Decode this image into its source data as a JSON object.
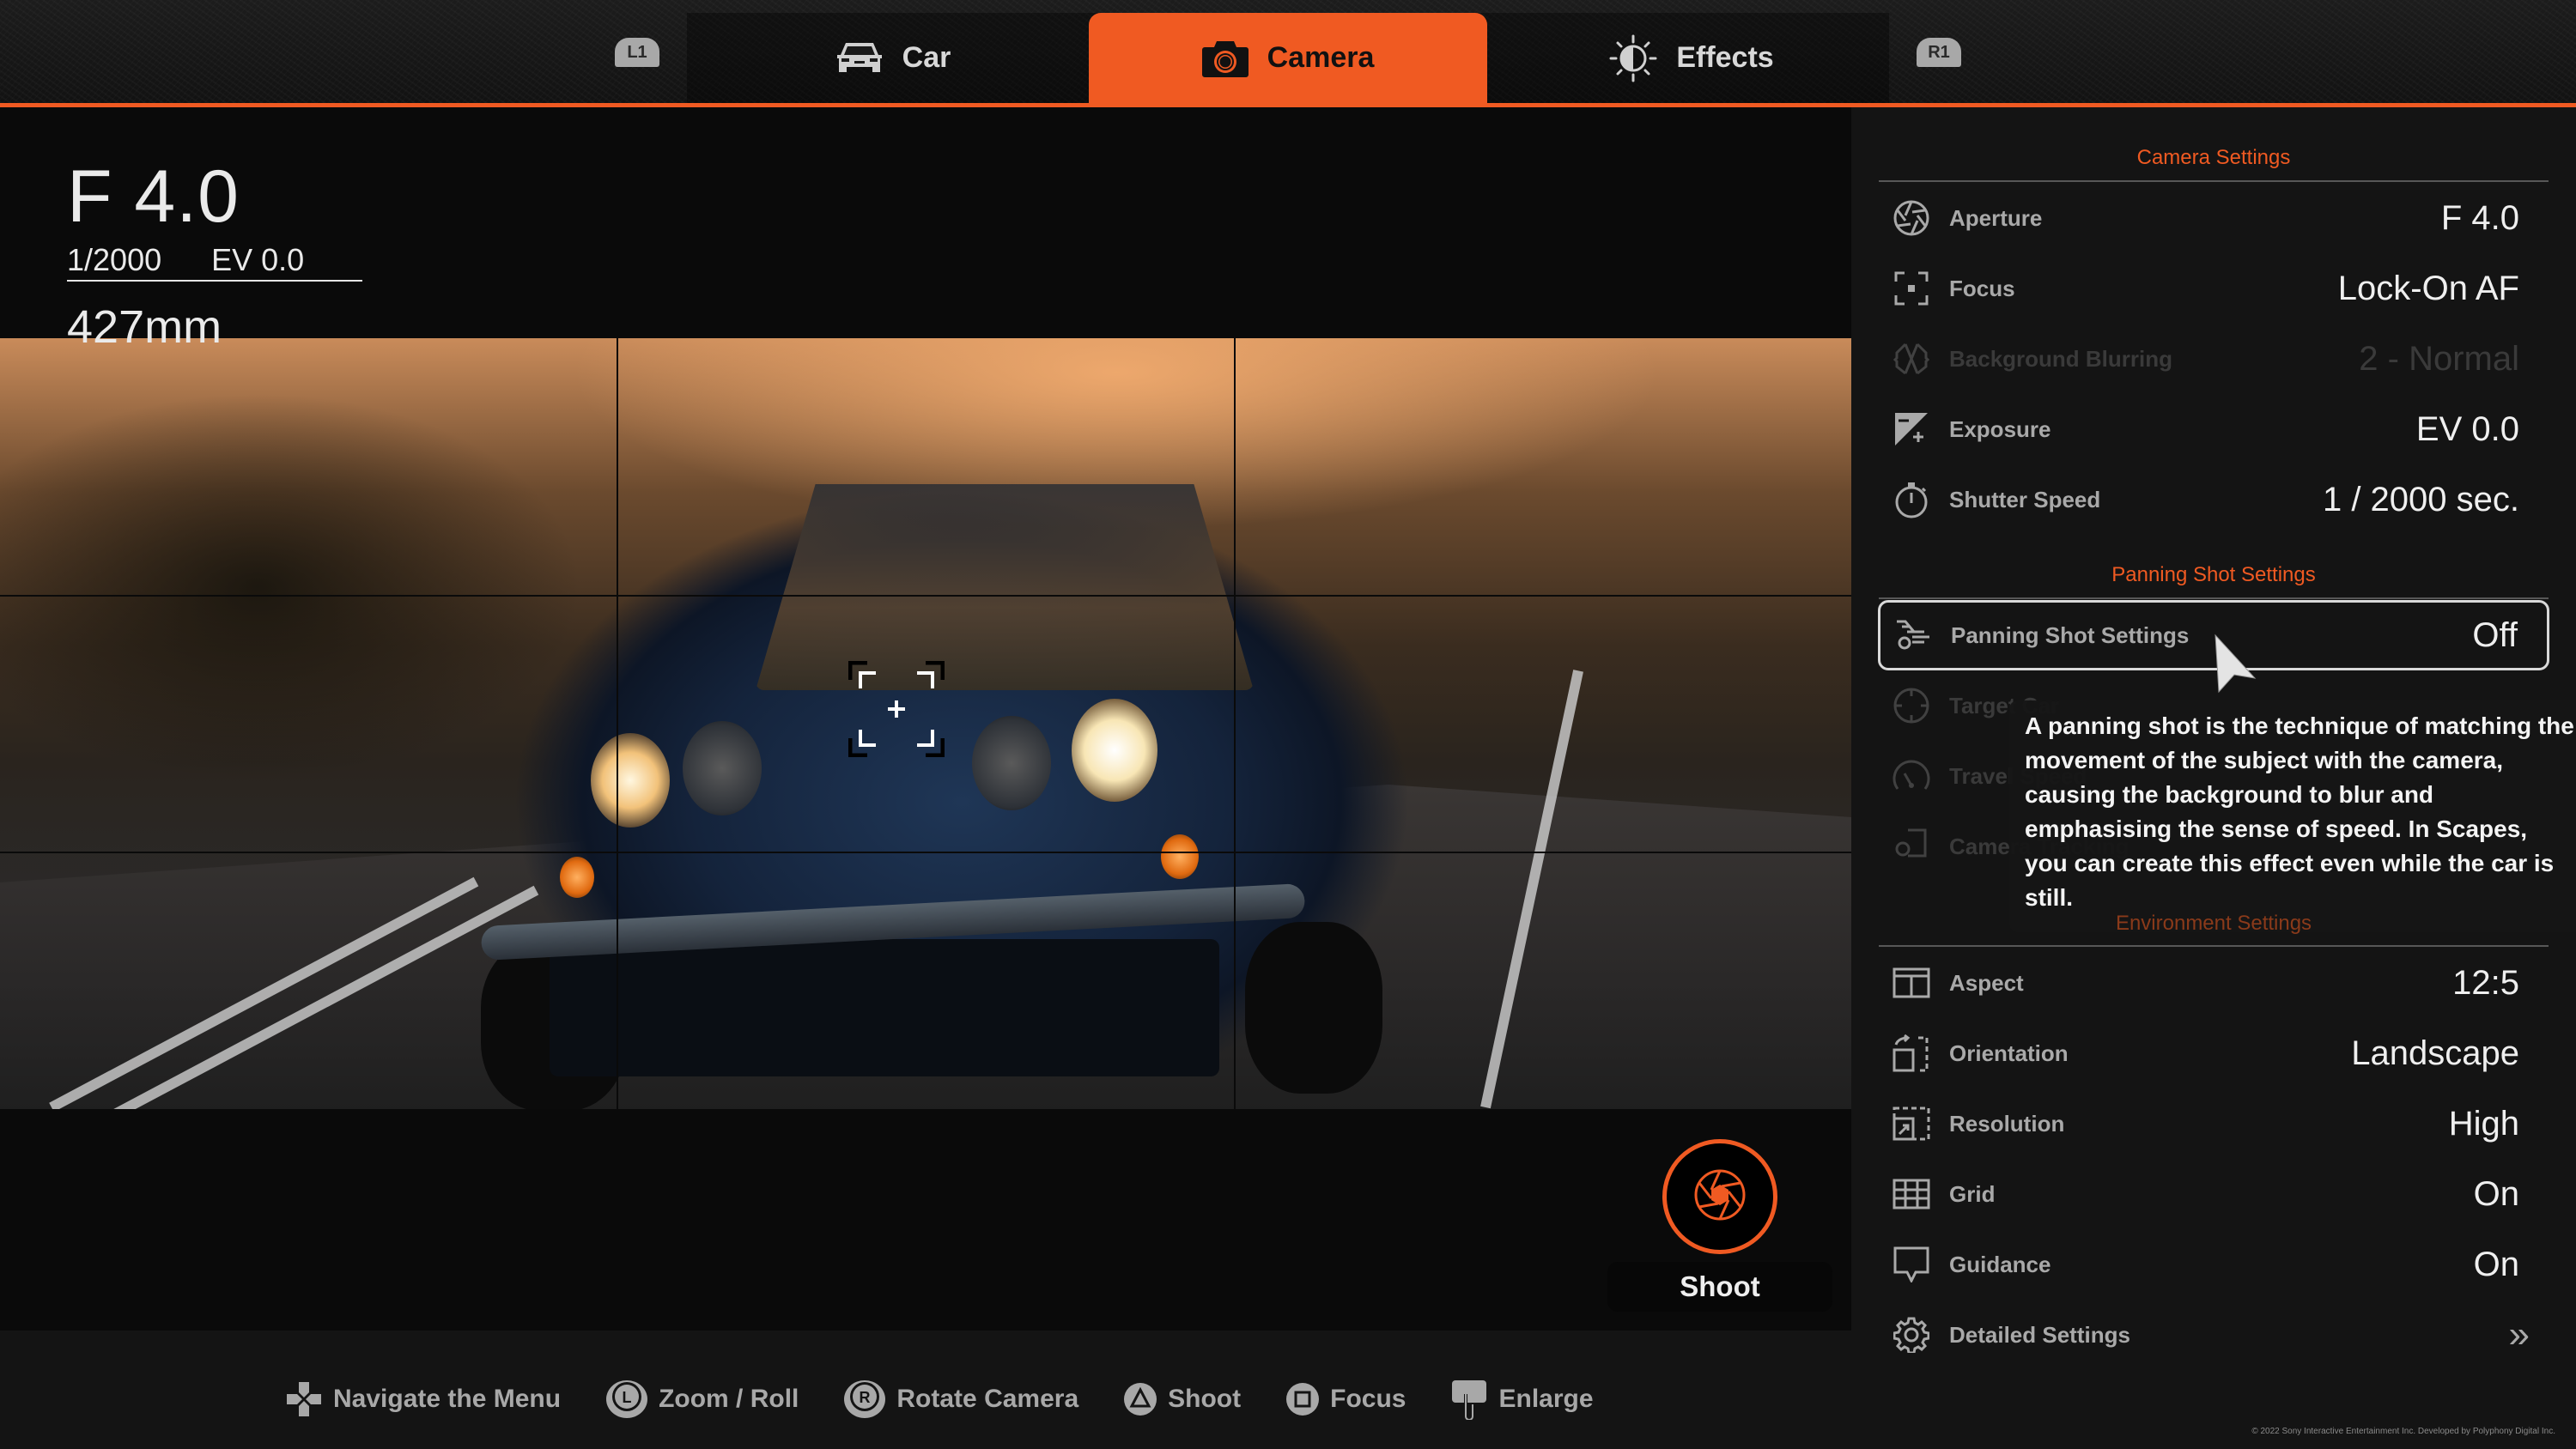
{
  "colors": {
    "accent": "#f05a22",
    "panel_bg": "#141414",
    "viewport_bg": "#0a0a0a"
  },
  "tabs": {
    "left_bumper": "L1",
    "right_bumper": "R1",
    "items": [
      {
        "label": "Car",
        "icon": "car-icon",
        "active": false
      },
      {
        "label": "Camera",
        "icon": "camera-icon",
        "active": true
      },
      {
        "label": "Effects",
        "icon": "brightness-contrast-icon",
        "active": false
      }
    ]
  },
  "hud": {
    "aperture": "F 4.0",
    "shutter": "1/2000",
    "exposure": "EV 0.0",
    "focal_length": "427mm"
  },
  "shoot_button": {
    "label": "Shoot",
    "icon": "shutter-icon"
  },
  "bottom_hints": [
    {
      "icon": "dpad-icon",
      "label": "Navigate the Menu"
    },
    {
      "icon": "l-stick-icon",
      "label": "Zoom / Roll"
    },
    {
      "icon": "r-stick-icon",
      "label": "Rotate Camera"
    },
    {
      "icon": "triangle-button-icon",
      "label": "Shoot"
    },
    {
      "icon": "square-button-icon",
      "label": "Focus"
    },
    {
      "icon": "touchpad-icon",
      "label": "Enlarge"
    }
  ],
  "panel": {
    "camera_settings_title": "Camera Settings",
    "camera_settings": [
      {
        "label": "Aperture",
        "value": "F 4.0",
        "icon": "aperture-icon",
        "enabled": true
      },
      {
        "label": "Focus",
        "value": "Lock-On AF",
        "icon": "focus-icon",
        "enabled": true
      },
      {
        "label": "Background Blurring",
        "value": "2 - Normal",
        "icon": "background-blur-icon",
        "enabled": false
      },
      {
        "label": "Exposure",
        "value": "EV 0.0",
        "icon": "exposure-icon",
        "enabled": true
      },
      {
        "label": "Shutter Speed",
        "value": "1 / 2000 sec.",
        "icon": "stopwatch-icon",
        "enabled": true
      }
    ],
    "panning_title": "Panning Shot Settings",
    "panning_settings": [
      {
        "label": "Panning Shot Settings",
        "value": "Off",
        "icon": "panning-car-icon",
        "enabled": true,
        "selected": true
      },
      {
        "label": "Target Car",
        "value": "",
        "icon": "target-icon",
        "enabled": false
      },
      {
        "label": "Travel Speed",
        "value": "",
        "icon": "speedometer-icon",
        "enabled": false
      },
      {
        "label": "Camera Tracking",
        "value": "",
        "icon": "camera-tracking-icon",
        "enabled": false
      }
    ],
    "tooltip": "A panning shot is the technique of matching the movement of the subject with the camera, causing the background to blur and emphasising the sense of speed. In Scapes, you can create this effect even while the car is still.",
    "environment_title": "Environment Settings",
    "environment_settings": [
      {
        "label": "Aspect",
        "value": "12:5",
        "icon": "aspect-icon"
      },
      {
        "label": "Orientation",
        "value": "Landscape",
        "icon": "orientation-icon"
      },
      {
        "label": "Resolution",
        "value": "High",
        "icon": "resolution-icon"
      },
      {
        "label": "Grid",
        "value": "On",
        "icon": "grid-icon"
      },
      {
        "label": "Guidance",
        "value": "On",
        "icon": "speech-bubble-icon"
      },
      {
        "label": "Detailed Settings",
        "value": "»",
        "icon": "gear-icon"
      }
    ]
  },
  "copyright": "© 2022 Sony Interactive Entertainment Inc. Developed by Polyphony Digital Inc."
}
